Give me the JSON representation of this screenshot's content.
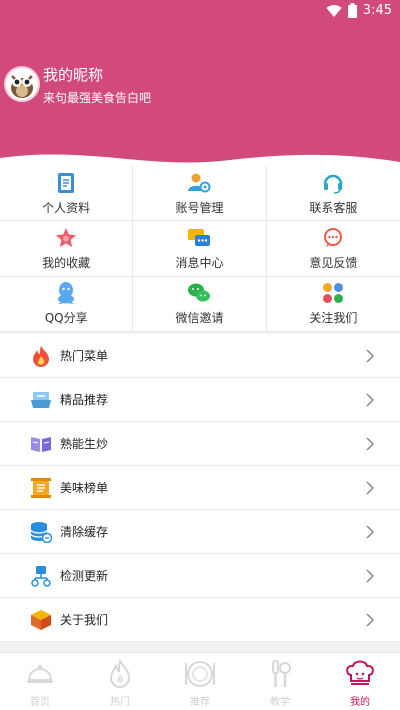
{
  "status": {
    "time": "3:45"
  },
  "profile": {
    "nickname": "我的昵称",
    "slogan": "来句最强美食告白吧"
  },
  "grid": [
    {
      "label": "个人资料",
      "icon": "profile-book-icon"
    },
    {
      "label": "账号管理",
      "icon": "account-manage-icon"
    },
    {
      "label": "联系客服",
      "icon": "headset-icon"
    },
    {
      "label": "我的收藏",
      "icon": "star-favorite-icon"
    },
    {
      "label": "消息中心",
      "icon": "message-center-icon"
    },
    {
      "label": "意见反馈",
      "icon": "feedback-chat-icon"
    },
    {
      "label": "QQ分享",
      "icon": "qq-icon"
    },
    {
      "label": "微信邀请",
      "icon": "wechat-icon"
    },
    {
      "label": "关注我们",
      "icon": "follow-petals-icon"
    }
  ],
  "list": [
    {
      "label": "热门菜单",
      "icon": "flame-icon"
    },
    {
      "label": "精品推荐",
      "icon": "tray-icon"
    },
    {
      "label": "熟能生炒",
      "icon": "open-book-icon"
    },
    {
      "label": "美味榜单",
      "icon": "scroll-list-icon"
    },
    {
      "label": "清除缓存",
      "icon": "database-icon"
    },
    {
      "label": "检测更新",
      "icon": "network-update-icon"
    },
    {
      "label": "关于我们",
      "icon": "cube-icon"
    }
  ],
  "tabs": [
    {
      "label": "首页",
      "icon": "cloche-icon",
      "active": false
    },
    {
      "label": "热门",
      "icon": "fire-icon",
      "active": false
    },
    {
      "label": "推荐",
      "icon": "plate-icon",
      "active": false
    },
    {
      "label": "教学",
      "icon": "utensils-icon",
      "active": false
    },
    {
      "label": "我的",
      "icon": "chef-hat-icon",
      "active": true
    }
  ],
  "colors": {
    "header": "#d24a7c",
    "active_tab": "#c2185b"
  }
}
